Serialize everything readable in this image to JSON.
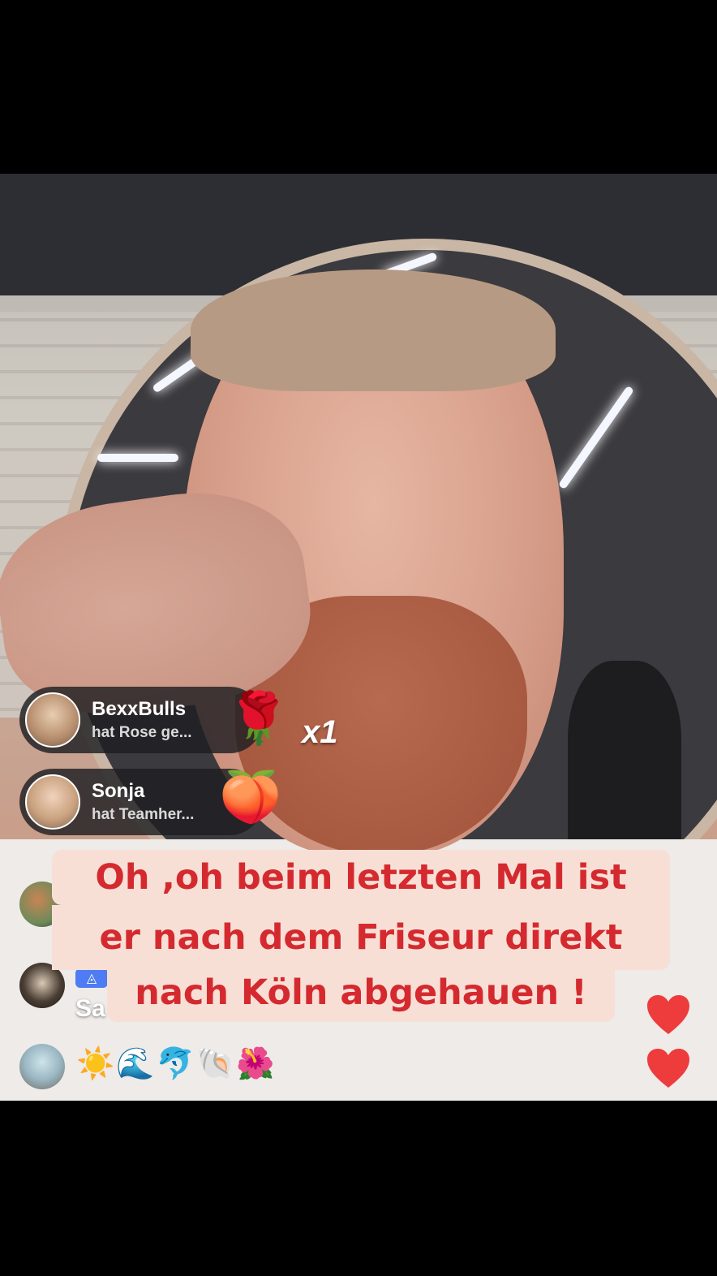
{
  "gifts": [
    {
      "user": "BexxBulls",
      "text": "hat Rose  ge...",
      "icon": "rose-emoji",
      "combo": "x1"
    },
    {
      "user": "Sonja",
      "text": "hat Teamher...",
      "icon": "peach-character-emoji"
    }
  ],
  "chat": {
    "user_partial": "Sa",
    "emoji_message": "☀️🌊🐬🐚🌺"
  },
  "caption": {
    "line1": "Oh ,oh beim letzten Mal ist",
    "line2": "er nach dem Friseur direkt",
    "line3": "nach Köln abgehauen !"
  },
  "colors": {
    "caption_text": "#d42a2f",
    "caption_bg": "#f8dfd6",
    "heart": "#ee3b3b"
  }
}
